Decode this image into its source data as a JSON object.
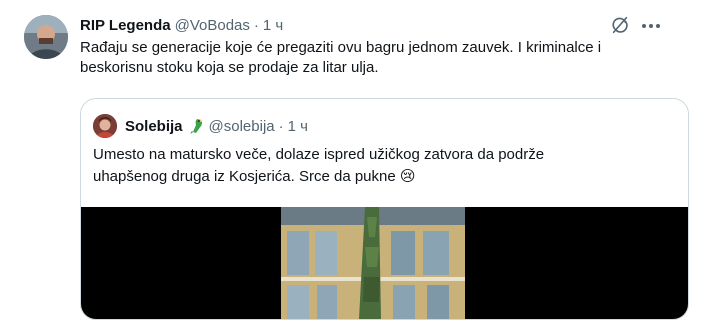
{
  "tweet": {
    "author_name": "RIP Legenda",
    "author_handle": "@VoBodas",
    "separator": "·",
    "time": "1 ч",
    "text": "Rađaju se generacije koje će pregaziti ovu bagru jednom zauvek. I kriminalce i beskorisnu stoku koja se prodaje za litar ulja."
  },
  "quoted": {
    "author_name": "Solebija",
    "author_emoji": "🦜",
    "author_handle": "@solebija",
    "separator": "·",
    "time": "1 ч",
    "text_line1": "Umesto na matursko veče, dolaze ispred užičkog zatvora da podrže",
    "text_line2": "uhapšenog druga iz Kosjerića. Srce da pukne 😢"
  },
  "icons": {
    "grok": "grok-icon",
    "more": "more-icon",
    "parrot": "parrot-emoji-icon"
  },
  "colors": {
    "text": "#0f1419",
    "secondary": "#536471",
    "border": "#cfd9de"
  }
}
